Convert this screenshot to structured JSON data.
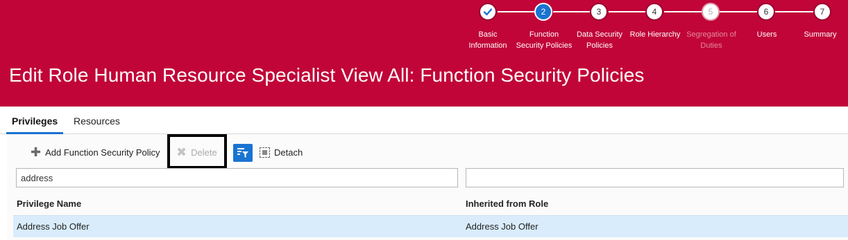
{
  "train": {
    "steps": [
      {
        "number": "",
        "label_lines": [
          "Basic",
          "Information"
        ],
        "state": "done",
        "icon": "checkmark-icon"
      },
      {
        "number": "2",
        "label_lines": [
          "Function",
          "Security Policies"
        ],
        "state": "active"
      },
      {
        "number": "3",
        "label_lines": [
          "Data Security",
          "Policies"
        ],
        "state": "normal"
      },
      {
        "number": "4",
        "label_lines": [
          "Role Hierarchy"
        ],
        "state": "normal"
      },
      {
        "number": "5",
        "label_lines": [
          "Segregation of",
          "Duties"
        ],
        "state": "disabled"
      },
      {
        "number": "6",
        "label_lines": [
          "Users"
        ],
        "state": "normal"
      },
      {
        "number": "7",
        "label_lines": [
          "Summary"
        ],
        "state": "normal"
      }
    ]
  },
  "header": {
    "title": "Edit Role Human Resource Specialist View All: Function Security Policies",
    "background_color": "#c10538"
  },
  "tabs": [
    {
      "label": "Privileges",
      "active": true
    },
    {
      "label": "Resources",
      "active": false
    }
  ],
  "toolbar": {
    "add_label": "Add Function Security Policy",
    "delete_label": "Delete",
    "detach_label": "Detach",
    "filter_icon": "query-by-example-icon"
  },
  "filters": {
    "privilege_name_value": "address",
    "inherited_from_role_value": ""
  },
  "table": {
    "columns": [
      "Privilege Name",
      "Inherited from Role"
    ],
    "rows": [
      {
        "privilege_name": "Address Job Offer",
        "inherited_from_role": "Address Job Offer",
        "selected": true
      }
    ]
  },
  "colors": {
    "accent": "#1a73d1",
    "selected_row": "#d9ecfb"
  }
}
